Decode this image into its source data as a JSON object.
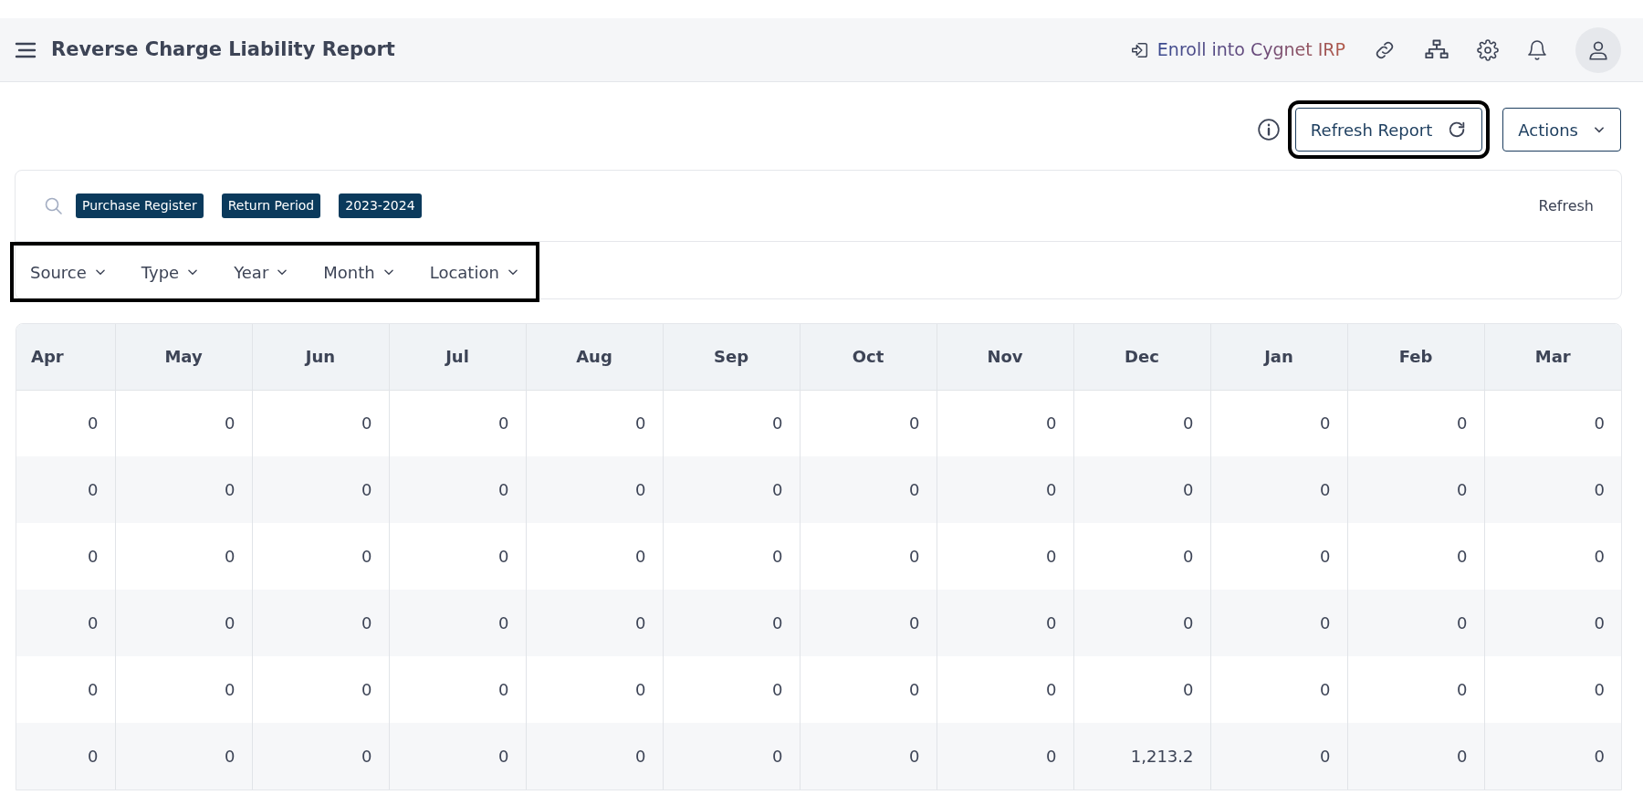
{
  "header": {
    "title": "Reverse Charge Liability Report",
    "enroll_link": "Enroll into Cygnet IRP"
  },
  "toolbar": {
    "refresh_button": {
      "label": "Refresh Report",
      "highlighted": true
    },
    "actions_button": {
      "label": "Actions"
    }
  },
  "filter_card": {
    "chips": [
      "Purchase Register",
      "Return Period",
      "2023-2024"
    ],
    "refresh_link": "Refresh",
    "filters_highlighted": true,
    "filters": [
      {
        "label": "Source"
      },
      {
        "label": "Type"
      },
      {
        "label": "Year"
      },
      {
        "label": "Month"
      },
      {
        "label": "Location"
      }
    ]
  },
  "table": {
    "columns": [
      "Apr",
      "May",
      "Jun",
      "Jul",
      "Aug",
      "Sep",
      "Oct",
      "Nov",
      "Dec",
      "Jan",
      "Feb",
      "Mar"
    ],
    "rows": [
      [
        "0",
        "0",
        "0",
        "0",
        "0",
        "0",
        "0",
        "0",
        "0",
        "0",
        "0",
        "0"
      ],
      [
        "0",
        "0",
        "0",
        "0",
        "0",
        "0",
        "0",
        "0",
        "0",
        "0",
        "0",
        "0"
      ],
      [
        "0",
        "0",
        "0",
        "0",
        "0",
        "0",
        "0",
        "0",
        "0",
        "0",
        "0",
        "0"
      ],
      [
        "0",
        "0",
        "0",
        "0",
        "0",
        "0",
        "0",
        "0",
        "0",
        "0",
        "0",
        "0"
      ],
      [
        "0",
        "0",
        "0",
        "0",
        "0",
        "0",
        "0",
        "0",
        "0",
        "0",
        "0",
        "0"
      ],
      [
        "0",
        "0",
        "0",
        "0",
        "0",
        "0",
        "0",
        "0",
        "1,213.2",
        "0",
        "0",
        "0"
      ]
    ]
  }
}
